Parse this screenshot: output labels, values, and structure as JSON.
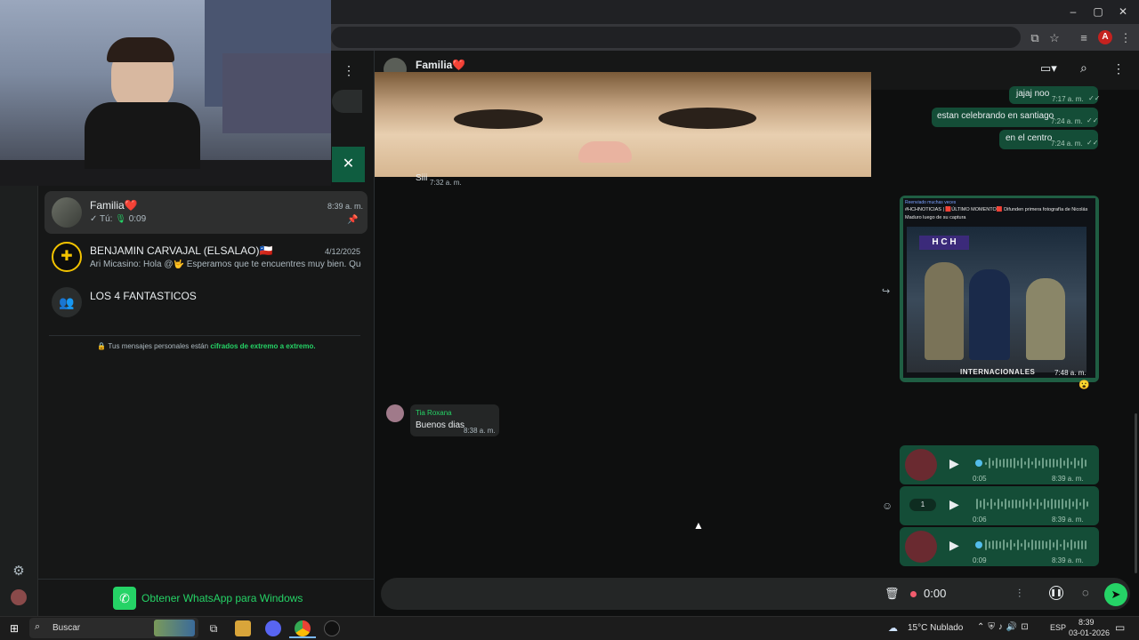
{
  "browser": {
    "window_controls": {
      "minimize": "–",
      "maximize": "▢",
      "close": "✕"
    },
    "profile_initial": "A"
  },
  "sidebar_panel": {
    "chats": [
      {
        "name": "Familia❤️",
        "time": "8:39 a. m.",
        "preview_prefix": "Tú:",
        "preview": "0:09",
        "pinned": true
      },
      {
        "name": "BENJAMIN CARVAJAL (ELSALAO)🇨🇱",
        "time": "4/12/2025",
        "preview": "Ari Micasino: Hola @🤟 Esperamos que te encuentres muy bien. Que..."
      },
      {
        "name": "LOS 4 FANTASTICOS",
        "time": "",
        "preview": ""
      }
    ],
    "encryption_prefix": "🔒 Tus mensajes personales están ",
    "encryption_link": "cifrados de extremo a extremo.",
    "get_app": "Obtener WhatsApp para Windows"
  },
  "chat": {
    "title": "Familia❤️",
    "messages_out": [
      {
        "text": "jajaj noo",
        "time": "7:17 a. m."
      },
      {
        "text": "estan celebrando en santiago",
        "time": "7:24 a. m."
      },
      {
        "text": "en el centro",
        "time": "7:24 a. m."
      }
    ],
    "image_msg_time": "7:32 a. m.",
    "image_msg_text": "Siii",
    "news_forward_label": "Reenviado muchas veces",
    "news_caption": "#HCHNOTICIAS | 🟥ÚLTIMO MOMENTO🟥 Difunden primera fotografía de Nicolás Maduro luego de su captura",
    "news_logo": "H C H",
    "news_footer": "INTERNACIONALES",
    "news_time": "7:48 a. m.",
    "news_reaction": "😮",
    "incoming": {
      "sender": "Tia Roxana",
      "text": "Buenos dias",
      "time": "8:38 a. m."
    },
    "voice_notes": [
      {
        "duration": "0:05",
        "time": "8:39 a. m."
      },
      {
        "duration": "0:06",
        "time": "8:39 a. m.",
        "speed": "1"
      },
      {
        "duration": "0:09",
        "time": "8:39 a. m."
      }
    ]
  },
  "composer": {
    "recording_time": "0:00"
  },
  "taskbar": {
    "search_placeholder": "Buscar",
    "weather": "15°C Nublado",
    "language": "ESP",
    "time": "8:39",
    "date": "03-01-2026"
  },
  "colors": {
    "accent": "#25d366",
    "outgoing_bubble": "#144d37",
    "incoming_bubble": "#242626"
  }
}
